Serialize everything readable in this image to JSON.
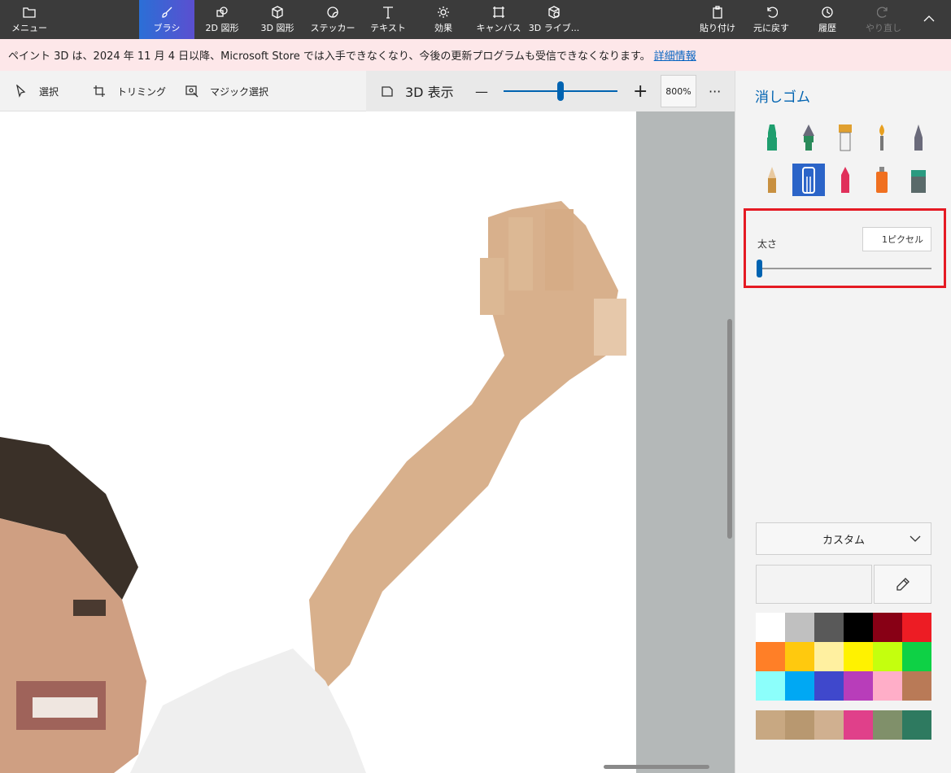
{
  "topbar": {
    "menu_label": "メニュー",
    "tabs": [
      {
        "label": "ブラシ",
        "icon": "brush-icon",
        "active": true
      },
      {
        "label": "2D 図形",
        "icon": "2d-shapes-icon"
      },
      {
        "label": "3D 図形",
        "icon": "3d-shapes-icon"
      },
      {
        "label": "ステッカー",
        "icon": "sticker-icon"
      },
      {
        "label": "テキスト",
        "icon": "text-icon"
      },
      {
        "label": "効果",
        "icon": "effects-icon"
      },
      {
        "label": "キャンバス",
        "icon": "canvas-icon"
      },
      {
        "label": "3D ライブ...",
        "icon": "3d-library-icon"
      }
    ],
    "actions": [
      {
        "label": "貼り付け",
        "icon": "paste-icon"
      },
      {
        "label": "元に戻す",
        "icon": "undo-icon"
      },
      {
        "label": "履歴",
        "icon": "history-icon"
      },
      {
        "label": "やり直し",
        "icon": "redo-icon",
        "disabled": true
      }
    ],
    "collapse_icon": "chevron-up-icon"
  },
  "notice": {
    "text": "ペイント 3D は、2024 年 11 月 4 日以降、Microsoft Store では入手できなくなり、今後の更新プログラムも受信できなくなります。",
    "link": "詳細情報"
  },
  "subbar": {
    "select_label": "選択",
    "crop_label": "トリミング",
    "magic_select_label": "マジック選択",
    "view3d_label": "3D 表示",
    "zoom_minus": "—",
    "zoom_plus": "+",
    "zoom_value": "800%",
    "more_label": "···",
    "zoom_level_fraction": 0.5
  },
  "panel": {
    "title": "消しゴム",
    "brushes": [
      {
        "name": "marker-brush",
        "color": "#1e9e6e"
      },
      {
        "name": "calligraphy-pen-brush",
        "color": "#2a8a5a"
      },
      {
        "name": "oil-brush",
        "color": "#e0a030"
      },
      {
        "name": "watercolor-brush",
        "color": "#e8a020"
      },
      {
        "name": "pixel-pen-brush",
        "color": "#6a6a7a"
      },
      {
        "name": "pencil-brush",
        "color": "#c89040"
      },
      {
        "name": "eraser-brush",
        "color": "#ffffff",
        "selected": true
      },
      {
        "name": "crayon-brush",
        "color": "#e0305a"
      },
      {
        "name": "spray-can-brush",
        "color": "#f07020"
      },
      {
        "name": "fill-bucket-brush",
        "color": "#2a9a80"
      }
    ],
    "thickness": {
      "label": "太さ",
      "value": "1ピクセル",
      "level_fraction": 0.0
    },
    "color_mode": "カスタム",
    "palette": [
      "#ffffff",
      "#c0c0c0",
      "#595959",
      "#000000",
      "#880015",
      "#ed1c24",
      "#ff7f27",
      "#ffc90e",
      "#fff0a0",
      "#fff200",
      "#c4ff0e",
      "#0ed145",
      "#8cfffb",
      "#00a8f3",
      "#3f48cc",
      "#b83dba",
      "#ffaec8",
      "#b97a57"
    ],
    "recent_colors": [
      "#c8a882",
      "#b89870",
      "#d0b090",
      "#e0408a",
      "#80906a",
      "#2e7a60"
    ]
  }
}
